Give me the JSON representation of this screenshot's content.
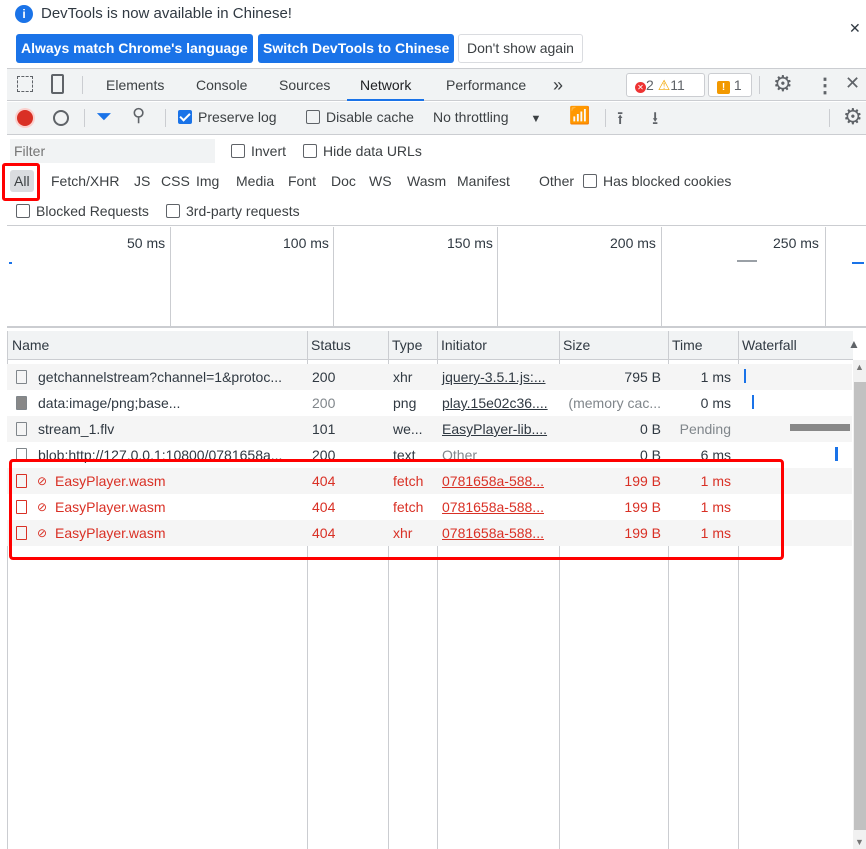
{
  "infobar": {
    "message": "DevTools is now available in Chinese!",
    "btn_match": "Always match Chrome's language",
    "btn_switch": "Switch DevTools to Chinese",
    "btn_dismiss": "Don't show again"
  },
  "tabs": [
    {
      "label": "Elements"
    },
    {
      "label": "Console"
    },
    {
      "label": "Sources"
    },
    {
      "label": "Network",
      "selected": true
    },
    {
      "label": "Performance"
    }
  ],
  "tabs_more": "»",
  "badges": {
    "errors": "2",
    "warnings": "11",
    "issues": "1"
  },
  "toolbar": {
    "preserve_log": "Preserve log",
    "preserve_checked": true,
    "disable_cache": "Disable cache",
    "throttling": "No throttling"
  },
  "filter": {
    "placeholder": "Filter",
    "invert": "Invert",
    "hide_data_urls": "Hide data URLs",
    "types": [
      "All",
      "Fetch/XHR",
      "JS",
      "CSS",
      "Img",
      "Media",
      "Font",
      "Doc",
      "WS",
      "Wasm",
      "Manifest",
      "Other"
    ],
    "has_blocked_cookies": "Has blocked cookies",
    "blocked_requests": "Blocked Requests",
    "third_party": "3rd-party requests"
  },
  "timeline": {
    "ticks": [
      "50 ms",
      "100 ms",
      "150 ms",
      "200 ms",
      "250 ms"
    ]
  },
  "table": {
    "headers": [
      "Name",
      "Status",
      "Type",
      "Initiator",
      "Size",
      "Time",
      "Waterfall"
    ],
    "rows": [
      {
        "name": "getchannelstream?channel=1&protoc...",
        "status": "200",
        "type": "xhr",
        "initiator": "jquery-3.5.1.js:...",
        "size": "795 B",
        "time": "1 ms",
        "error": false
      },
      {
        "name": "data:image/png;base...",
        "status": "200",
        "type": "png",
        "initiator": "play.15e02c36....",
        "size": "(memory cac...",
        "time": "0 ms",
        "error": false
      },
      {
        "name": "stream_1.flv",
        "status": "101",
        "type": "we...",
        "initiator": "EasyPlayer-lib....",
        "size": "0 B",
        "time": "Pending",
        "error": false
      },
      {
        "name": "blob:http://127.0.0.1:10800/0781658a...",
        "status": "200",
        "type": "text",
        "initiator": "Other",
        "size": "0 B",
        "time": "6 ms",
        "error": false
      },
      {
        "name": "EasyPlayer.wasm",
        "status": "404",
        "type": "fetch",
        "initiator": "0781658a-588...",
        "size": "199 B",
        "time": "1 ms",
        "error": true
      },
      {
        "name": "EasyPlayer.wasm",
        "status": "404",
        "type": "fetch",
        "initiator": "0781658a-588...",
        "size": "199 B",
        "time": "1 ms",
        "error": true
      },
      {
        "name": "EasyPlayer.wasm",
        "status": "404",
        "type": "xhr",
        "initiator": "0781658a-588...",
        "size": "199 B",
        "time": "1 ms",
        "error": true
      }
    ]
  },
  "colors": {
    "accent": "#1a73e8",
    "error": "#d93025",
    "highlight": "#ff0000"
  }
}
